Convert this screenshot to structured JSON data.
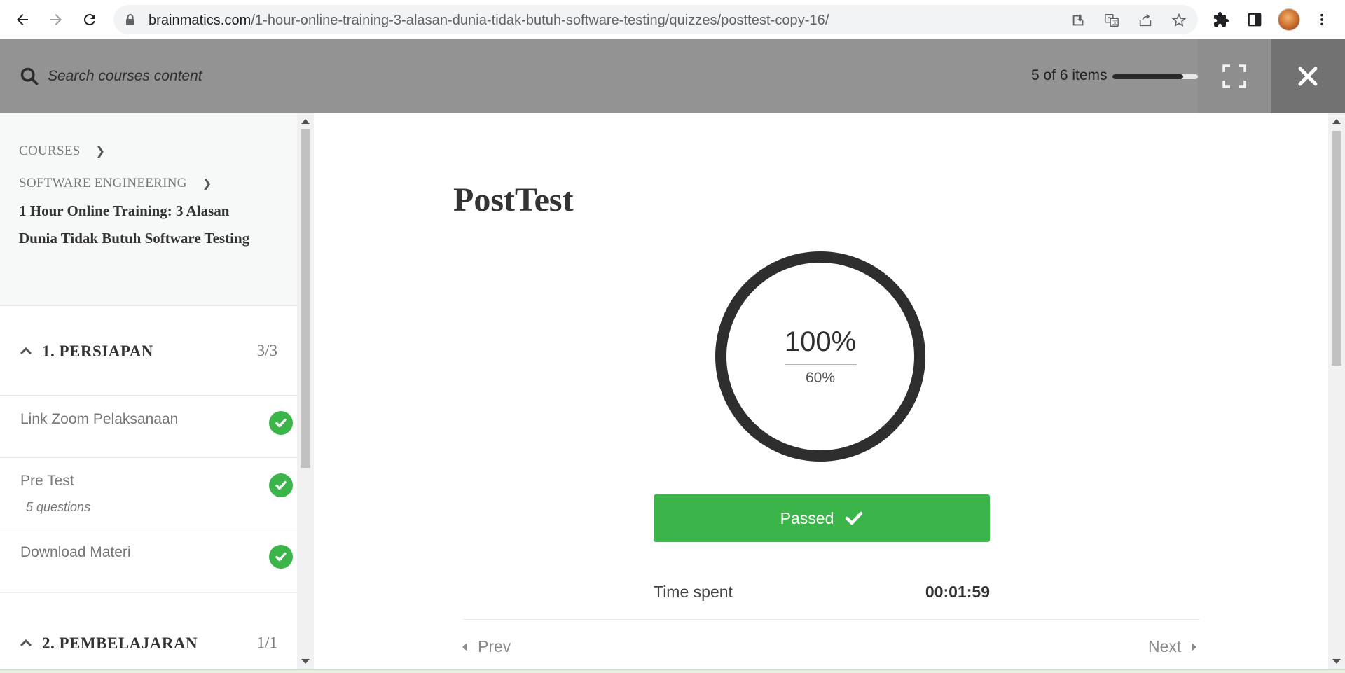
{
  "browser": {
    "url_host": "brainmatics.com",
    "url_path": "/1-hour-online-training-3-alasan-dunia-tidak-butuh-software-testing/quizzes/posttest-copy-16/"
  },
  "topbar": {
    "search_placeholder": "Search courses content",
    "items_label": "5 of 6 items",
    "progress": 0.83
  },
  "sidebar": {
    "breadcrumbs": [
      "COURSES",
      "SOFTWARE ENGINEERING"
    ],
    "course_title": "1 Hour Online Training: 3 Alasan Dunia Tidak Butuh Software Testing",
    "sections": [
      {
        "title": "1. PERSIAPAN",
        "count": "3/3",
        "lessons": [
          {
            "title": "Link Zoom Pelaksanaan",
            "sub": "",
            "completed": true
          },
          {
            "title": "Pre Test",
            "sub": "5 questions",
            "completed": true
          },
          {
            "title": "Download Materi",
            "sub": "",
            "completed": true
          }
        ]
      },
      {
        "title": "2. PEMBELAJARAN",
        "count": "1/1"
      }
    ]
  },
  "quiz": {
    "title": "PostTest",
    "score": "100%",
    "passing_grade": "60%",
    "status_label": "Passed",
    "time_label": "Time spent",
    "time_value": "00:01:59",
    "prev_label": "Prev",
    "next_label": "Next"
  },
  "colors": {
    "success": "#3bb54a",
    "topbar": "#939393"
  }
}
